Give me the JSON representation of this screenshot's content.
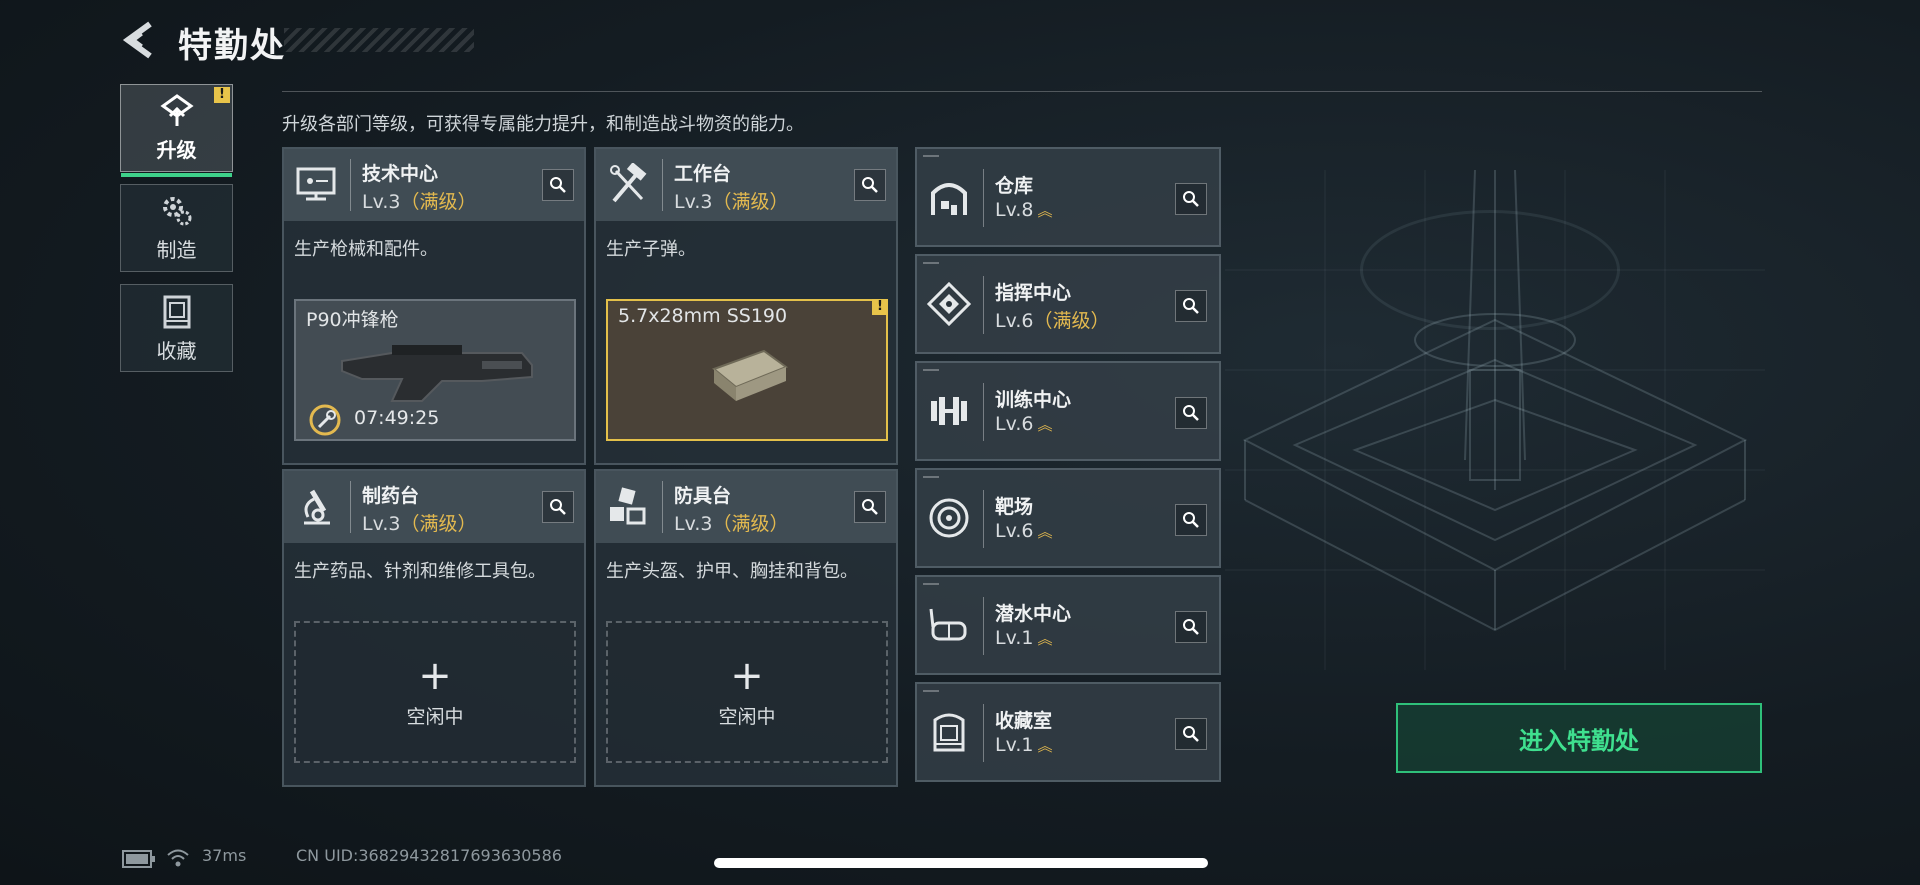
{
  "header": {
    "title": "特勤处"
  },
  "sidebar": {
    "tabs": [
      {
        "label": "升级",
        "active": true,
        "badge": "!"
      },
      {
        "label": "制造",
        "active": false
      },
      {
        "label": "收藏",
        "active": false
      }
    ]
  },
  "main": {
    "description": "升级各部门等级，可获得专属能力提升，和制造战斗物资的能力。",
    "cards": [
      {
        "name": "技术中心",
        "level": "Lv.3",
        "max": "（满级）",
        "desc": "生产枪械和配件。",
        "slot": {
          "state": "producing",
          "title": "P90冲锋枪",
          "timer": "07:49:25"
        }
      },
      {
        "name": "工作台",
        "level": "Lv.3",
        "max": "（满级）",
        "desc": "生产子弹。",
        "slot": {
          "state": "ready",
          "title": "5.7x28mm SS190",
          "badge": "!"
        }
      },
      {
        "name": "制药台",
        "level": "Lv.3",
        "max": "（满级）",
        "desc": "生产药品、针剂和维修工具包。",
        "slot": {
          "state": "idle",
          "plus": "+",
          "label": "空闲中"
        }
      },
      {
        "name": "防具台",
        "level": "Lv.3",
        "max": "（满级）",
        "desc": "生产头盔、护甲、胸挂和背包。",
        "slot": {
          "state": "idle",
          "plus": "+",
          "label": "空闲中"
        }
      }
    ],
    "facilities": [
      {
        "name": "仓库",
        "level": "Lv.8",
        "max": "",
        "upgradable": true,
        "icon": "warehouse-icon"
      },
      {
        "name": "指挥中心",
        "level": "Lv.6",
        "max": "（满级）",
        "upgradable": false,
        "icon": "command-icon"
      },
      {
        "name": "训练中心",
        "level": "Lv.6",
        "max": "",
        "upgradable": true,
        "icon": "dumbbell-icon"
      },
      {
        "name": "靶场",
        "level": "Lv.6",
        "max": "",
        "upgradable": true,
        "icon": "target-icon"
      },
      {
        "name": "潜水中心",
        "level": "Lv.1",
        "max": "",
        "upgradable": true,
        "icon": "diving-mask-icon"
      },
      {
        "name": "收藏室",
        "level": "Lv.1",
        "max": "",
        "upgradable": true,
        "icon": "collection-icon"
      }
    ],
    "enter_button": "进入特勤处",
    "upgrade_chevron": "︽"
  },
  "status_bar": {
    "ping": "37ms",
    "uid": "CN UID:36829432817693630586"
  },
  "colors": {
    "accent_green": "#3fe08f",
    "max_gold": "#e3b94f",
    "warn_yellow": "#e8c44a"
  }
}
